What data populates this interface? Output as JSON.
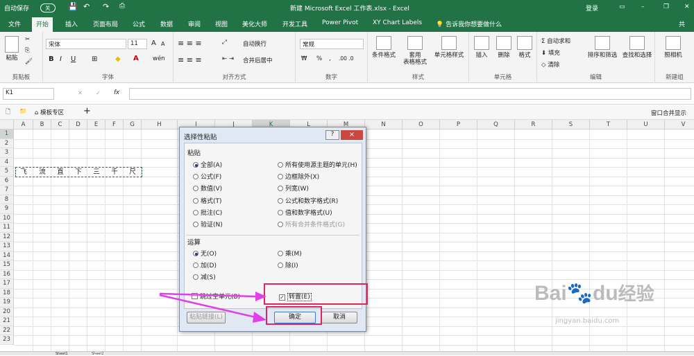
{
  "titlebar": {
    "autosave": "自动保存",
    "autosave_state": "关",
    "title": "新建 Microsoft Excel 工作表.xlsx - Excel",
    "login": "登录"
  },
  "tabs": [
    "文件",
    "开始",
    "插入",
    "页面布局",
    "公式",
    "数据",
    "审阅",
    "视图",
    "美化大师",
    "开发工具",
    "Power Pivot",
    "XY Chart Labels",
    "告诉我你想要做什么",
    "共"
  ],
  "ribbon": {
    "clipboard": {
      "label": "剪贴板",
      "paste": "粘贴"
    },
    "font": {
      "label": "字体",
      "name": "宋体",
      "size": "11",
      "bold": "B",
      "italic": "I",
      "underline": "U",
      "grow": "A",
      "shrink": "A",
      "wen": "wén"
    },
    "align": {
      "label": "对齐方式",
      "wrap": "自动换行",
      "merge": "合并后居中"
    },
    "number": {
      "label": "数字",
      "format": "常规",
      "percent": "%",
      "comma": ","
    },
    "styles": {
      "label": "样式",
      "cond": "条件格式",
      "table": "套用\n表格格式",
      "cell": "单元格样式"
    },
    "cells": {
      "label": "单元格",
      "insert": "插入",
      "delete": "删除",
      "format": "格式"
    },
    "edit": {
      "label": "编辑",
      "autosum": "自动求和",
      "fill": "填充",
      "clear": "清除",
      "sort": "排序和筛选",
      "find": "查找和选择"
    },
    "newgroup": {
      "label": "新建组",
      "camera": "照相机"
    }
  },
  "formula": {
    "namebox": "K1",
    "fx": "fx"
  },
  "toolstrip": {
    "template": "模板专区",
    "plus": "+",
    "merge_window": "窗口合并显示"
  },
  "columns": [
    "A",
    "B",
    "C",
    "D",
    "E",
    "F",
    "G",
    "H",
    "I",
    "J",
    "K",
    "L",
    "M",
    "N",
    "O",
    "P",
    "Q",
    "R",
    "S",
    "T",
    "U",
    "V"
  ],
  "rows": [
    "1",
    "2",
    "3",
    "4",
    "5",
    "6",
    "7",
    "8",
    "9",
    "10",
    "11",
    "12",
    "13",
    "14",
    "15",
    "16",
    "17",
    "18",
    "19",
    "20",
    "21",
    "22",
    "23"
  ],
  "row5_cells": [
    "飞",
    "流",
    "直",
    "下",
    "三",
    "千",
    "尺"
  ],
  "sheets": [
    "Sheet1",
    "Sheet2"
  ],
  "dialog": {
    "title": "选择性粘贴",
    "help": "?",
    "close": "×",
    "paste_section": "粘贴",
    "paste_left": [
      "全部(A)",
      "公式(F)",
      "数值(V)",
      "格式(T)",
      "批注(C)",
      "验证(N)"
    ],
    "paste_right": [
      "所有使用源主题的单元(H)",
      "边框除外(X)",
      "列宽(W)",
      "公式和数字格式(R)",
      "值和数字格式(U)",
      "所有合并条件格式(G)"
    ],
    "op_section": "运算",
    "op_left": [
      "无(O)",
      "加(D)",
      "减(S)"
    ],
    "op_right": [
      "乘(M)",
      "除(I)"
    ],
    "skip_blanks": "跳过空单元(B)",
    "transpose": "转置(E)",
    "transpose_check": "✓",
    "paste_link": "粘贴链接(L)",
    "ok": "确定",
    "cancel": "取消"
  },
  "watermark": {
    "brand": "Bai",
    "brand2": "du",
    "cn": "经验",
    "url": "jingyan.baidu.com"
  },
  "colors": {
    "excel_green": "#217346",
    "highlight": "#e0245e",
    "arrow": "#e040e8"
  }
}
